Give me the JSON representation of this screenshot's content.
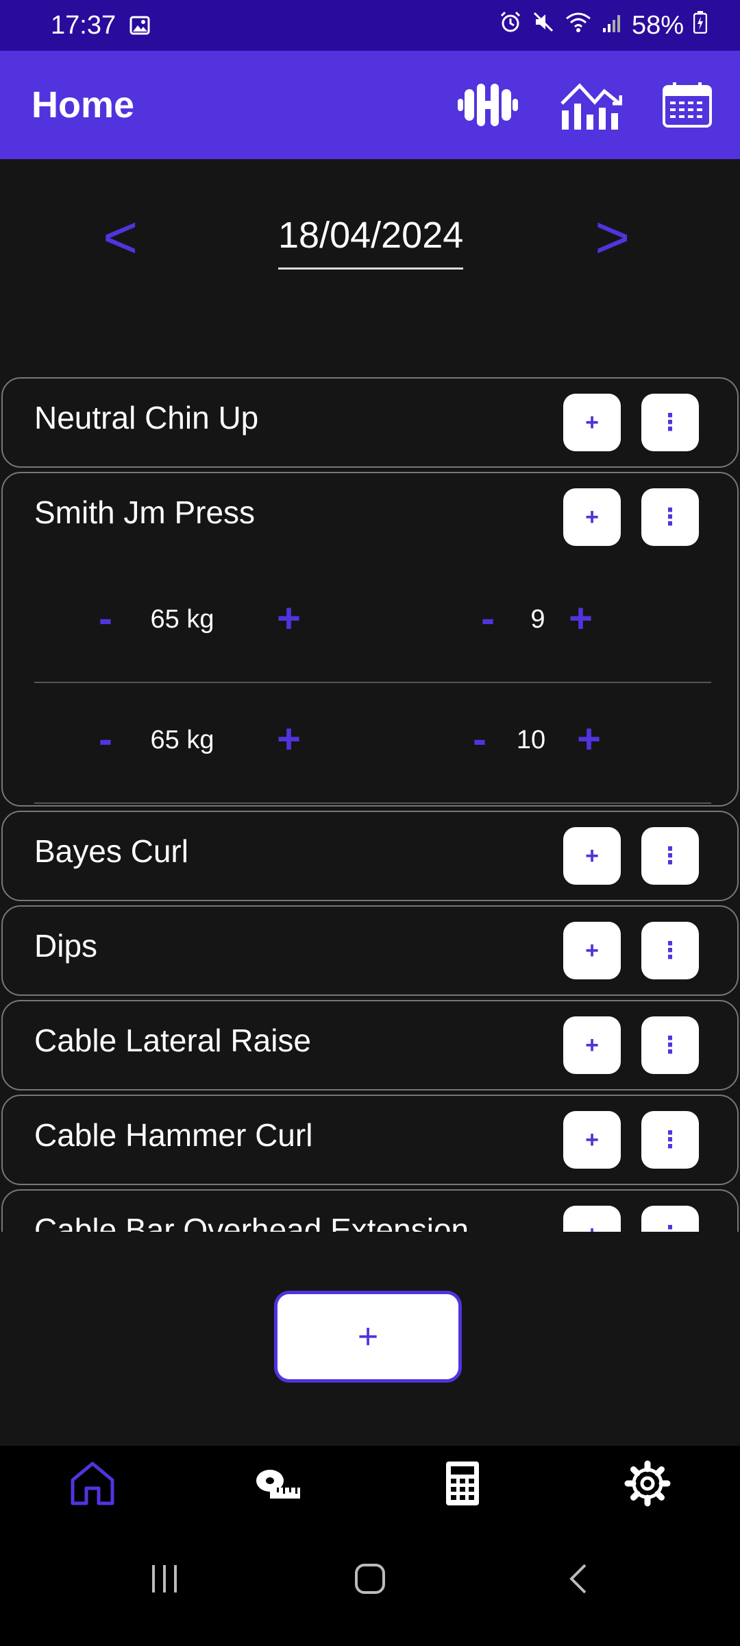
{
  "status": {
    "time": "17:37",
    "battery": "58%"
  },
  "appbar": {
    "title": "Home",
    "icons": [
      "dumbbell-icon",
      "chart-icon",
      "calendar-icon"
    ]
  },
  "date": {
    "prev": "<",
    "value": "18/04/2024",
    "next": ">"
  },
  "exercises": [
    {
      "name": "Neutral Chin Up"
    },
    {
      "name": "Smith Jm Press",
      "sets": [
        {
          "weight": "65 kg",
          "reps": "9"
        },
        {
          "weight": "65 kg",
          "reps": "10"
        }
      ]
    },
    {
      "name": "Bayes Curl"
    },
    {
      "name": "Dips"
    },
    {
      "name": "Cable Lateral Raise"
    },
    {
      "name": "Cable Hammer Curl"
    },
    {
      "name": "Cable Bar Overhead Extension"
    }
  ],
  "buttons": {
    "add": "+",
    "more": "⋮",
    "minus": "-",
    "plus": "+",
    "fab": "+"
  },
  "bottom_nav": [
    "home-icon",
    "tape-measure-icon",
    "calculator-icon",
    "settings-icon"
  ],
  "colors": {
    "accent": "#5233de",
    "statusbar": "#2a0c9c",
    "background": "#151515"
  }
}
